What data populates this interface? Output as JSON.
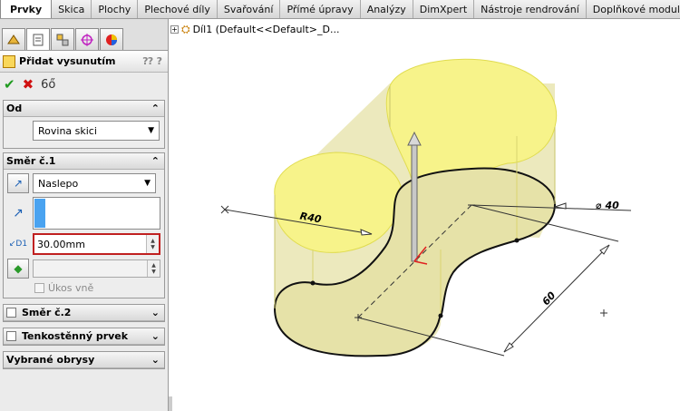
{
  "tabs": [
    "Prvky",
    "Skica",
    "Plochy",
    "Plechové díly",
    "Svařování",
    "Přímé úpravy",
    "Analýzy",
    "DimXpert",
    "Nástroje rendrování",
    "Doplňkové moduly"
  ],
  "feature_tree": {
    "part_label": "Díl1  (Default<<Default>_D..."
  },
  "property_manager": {
    "title": "Přidat vysunutím",
    "help_icon": "help-icon",
    "from_group": {
      "title": "Od",
      "selected": "Rovina skici"
    },
    "direction1": {
      "title": "Směr č.1",
      "end_condition": "Naslepo",
      "depth_value": "30.00mm",
      "draft_outward_label": "Úkos vně"
    },
    "direction2": {
      "title": "Směr č.2"
    },
    "thin_feature": {
      "title": "Tenkostěnný prvek"
    },
    "selected_contours": {
      "title": "Vybrané obrysy"
    }
  },
  "dimensions": {
    "radius": "R40",
    "diameter": "⌀ 40",
    "length": "60"
  },
  "colors": {
    "accent_yellow": "#f7f38a",
    "part_face": "#e9e6b0",
    "ok_green": "#1f9b1f",
    "cancel_red": "#d01010",
    "error_border": "#c02020"
  }
}
